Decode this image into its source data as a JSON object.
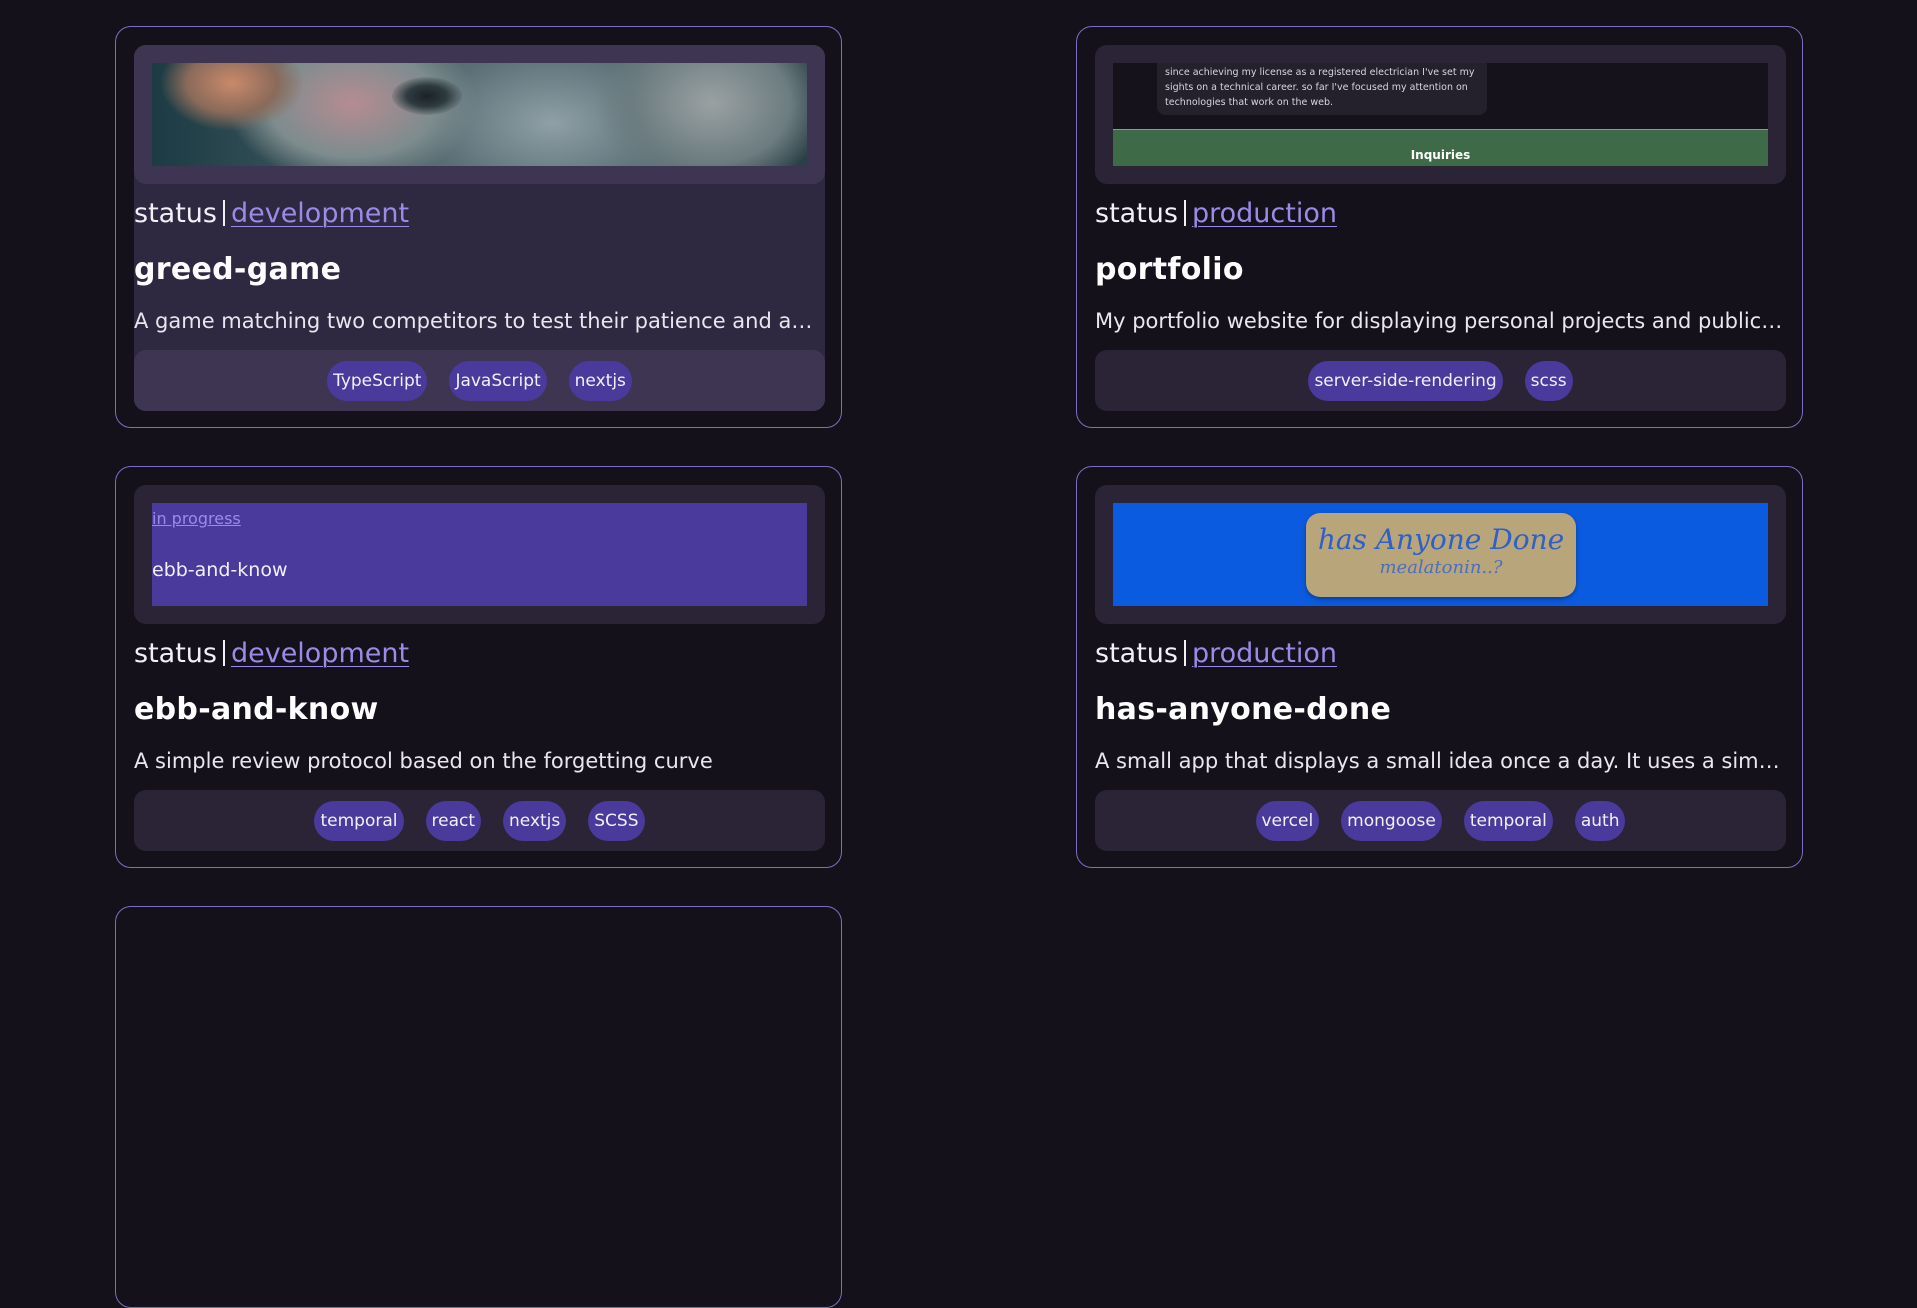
{
  "cards": [
    {
      "status_label": "status",
      "status_value": "development",
      "title": "greed-game",
      "description": "A game matching two competitors to test their patience and ambition",
      "tags": [
        "TypeScript",
        "JavaScript",
        "nextjs"
      ],
      "preview": {
        "type": "image",
        "icon": "creature-photo"
      }
    },
    {
      "status_label": "status",
      "status_value": "production",
      "title": "portfolio",
      "description": "My portfolio website for displaying personal projects and public work",
      "tags": [
        "server-side-rendering",
        "scss"
      ],
      "preview": {
        "type": "site",
        "text": "since achieving my license as a registered electrician I've set my sights on a technical career. so far I've focused my attention on technologies that work on the web.",
        "button": "Inquiries"
      }
    },
    {
      "status_label": "status",
      "status_value": "development",
      "title": "ebb-and-know",
      "description": "A simple review protocol based on the forgetting curve",
      "tags": [
        "temporal",
        "react",
        "nextjs",
        "SCSS"
      ],
      "preview": {
        "type": "site",
        "link": "in progress",
        "name": "ebb-and-know"
      }
    },
    {
      "status_label": "status",
      "status_value": "production",
      "title": "has-anyone-done",
      "description": "A small app that displays a small idea once a day. It uses a simple cron job",
      "tags": [
        "vercel",
        "mongoose",
        "temporal",
        "auth"
      ],
      "preview": {
        "type": "site",
        "line1": "has Anyone Done",
        "line2": "mealatonin..?"
      }
    }
  ],
  "colors": {
    "background": "#14111a",
    "card_border": "#7b6fc4",
    "link": "#9a8ce6",
    "tag_bg": "#4a3a9c"
  }
}
